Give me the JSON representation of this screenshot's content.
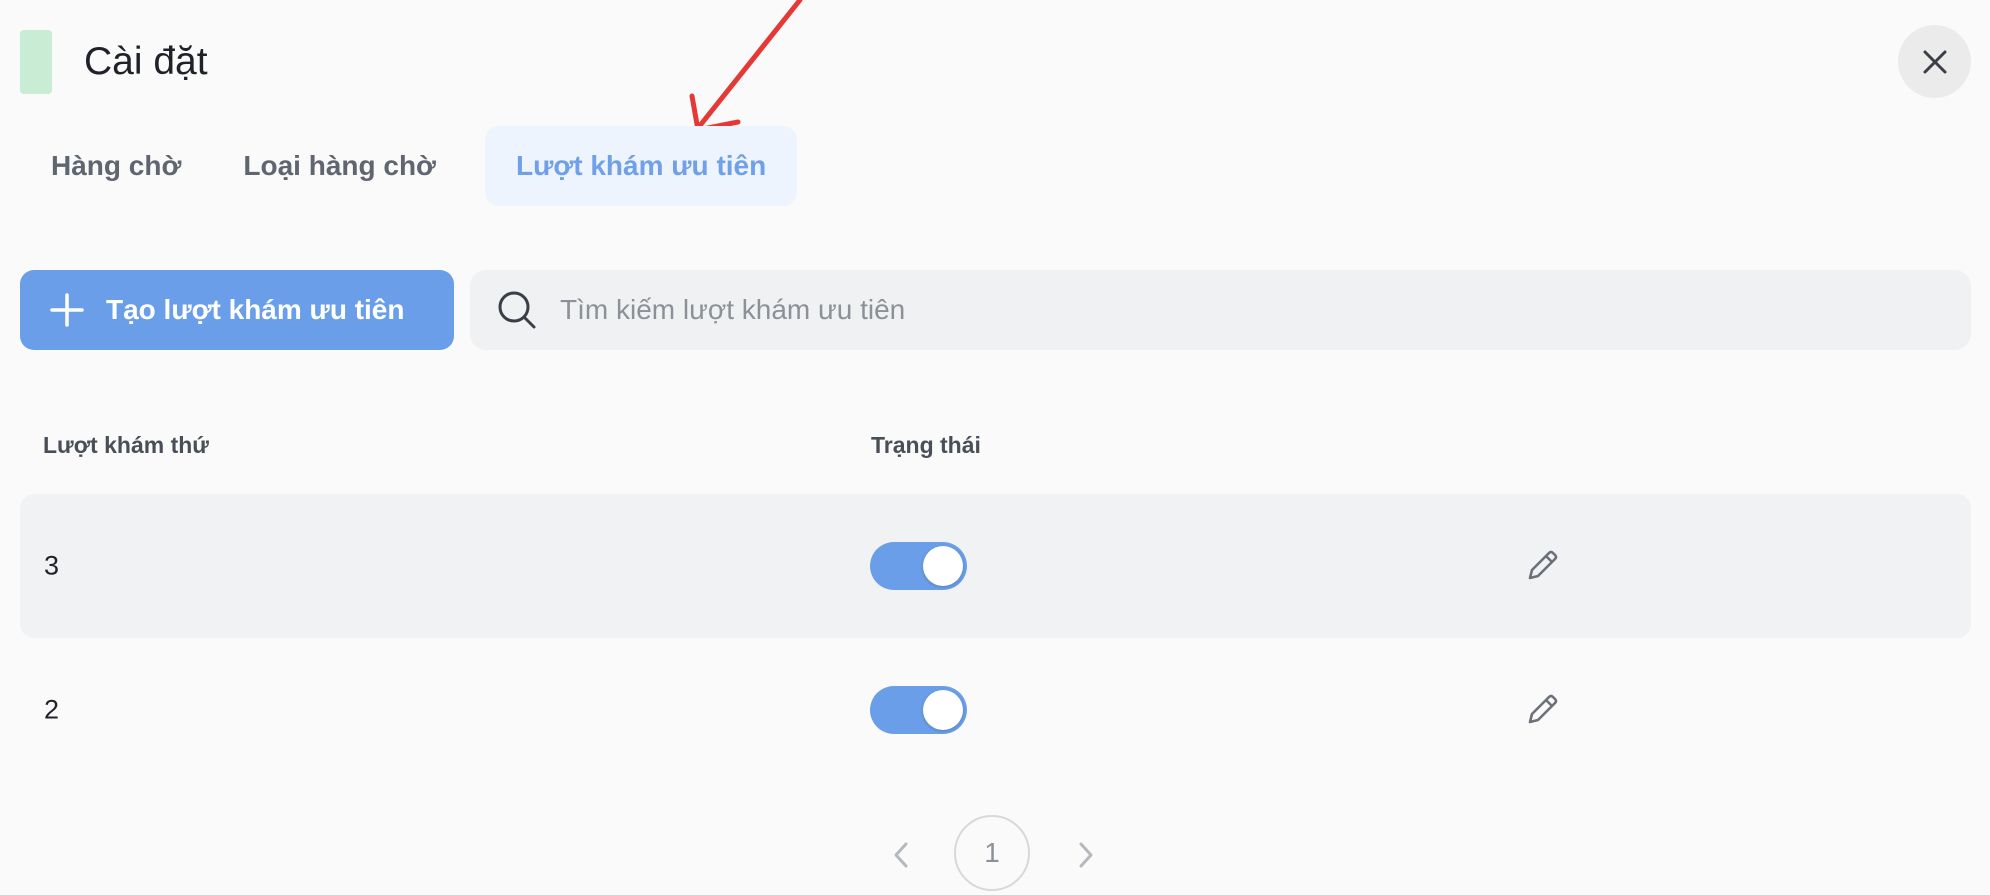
{
  "header": {
    "title": "Cài đặt",
    "close_icon": "close-icon",
    "accent_color": "#c8ecd4"
  },
  "tabs": [
    {
      "label": "Hàng chờ",
      "active": false
    },
    {
      "label": "Loại hàng chờ",
      "active": false
    },
    {
      "label": "Lượt khám ưu tiên",
      "active": true
    }
  ],
  "toolbar": {
    "create_label": "Tạo lượt khám ưu tiên",
    "create_icon": "plus-icon",
    "search_placeholder": "Tìm kiếm lượt khám ưu tiên",
    "search_value": "",
    "search_icon": "search-icon"
  },
  "table": {
    "columns": [
      "Lượt khám thứ",
      "Trạng thái"
    ],
    "rows": [
      {
        "visit_number": "3",
        "status_enabled": true
      },
      {
        "visit_number": "2",
        "status_enabled": true
      }
    ]
  },
  "pagination": {
    "current_page": "1"
  },
  "colors": {
    "primary": "#6a9ee8",
    "active_tab_bg": "#eef4fd",
    "annotation_arrow": "#e53935"
  }
}
